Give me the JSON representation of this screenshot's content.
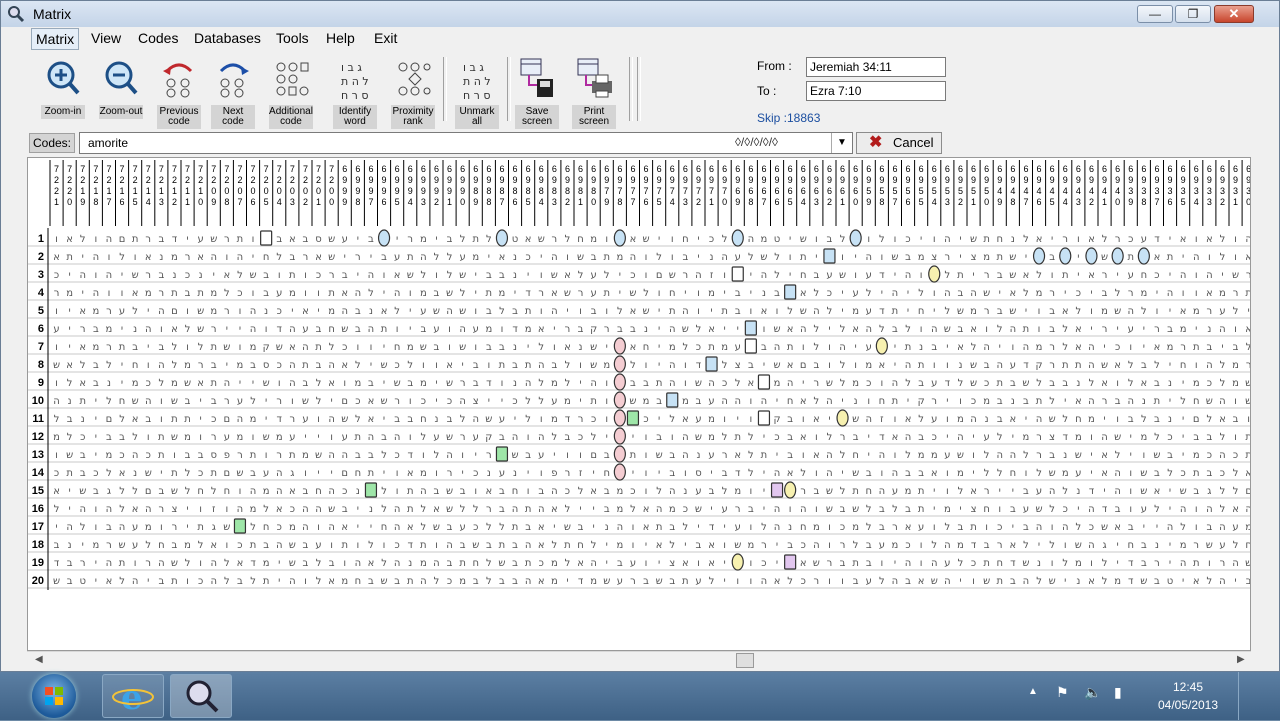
{
  "window": {
    "title": "Matrix",
    "min_label": "—",
    "max_label": "❐",
    "close_label": "✕"
  },
  "menu": [
    {
      "label": "Matrix",
      "name": "menu-matrix"
    },
    {
      "label": "View",
      "name": "menu-view"
    },
    {
      "label": "Codes",
      "name": "menu-codes"
    },
    {
      "label": "Databases",
      "name": "menu-databases"
    },
    {
      "label": "Tools",
      "name": "menu-tools"
    },
    {
      "label": "Help",
      "name": "menu-help"
    },
    {
      "label": "Exit",
      "name": "menu-exit"
    }
  ],
  "toolbar": {
    "zoom_in": "Zoom-in",
    "zoom_out": "Zoom-out",
    "previous_code": "Previous code",
    "next_code": "Next code",
    "additional_code": "Additional code",
    "identify_word": "Identify word",
    "proximity_rank": "Proximity rank",
    "unmark_all": "Unmark all",
    "save_screen": "Save screen",
    "print_screen": "Print screen"
  },
  "range": {
    "from_label": "From :",
    "from_value": "Jeremiah 34:11",
    "to_label": "To :",
    "to_value": "Ezra 7:10",
    "skip": "Skip :18863"
  },
  "codes": {
    "label": "Codes:",
    "value": "amorite",
    "glyphs": "◊/◊/◊/◊/◊",
    "dropdown": "▼",
    "cancel_icon": "✖",
    "cancel_label": "Cancel"
  },
  "matrix": {
    "column_numbers": [
      "7221",
      "7220",
      "7219",
      "7218",
      "7217",
      "7216",
      "7215",
      "7214",
      "7213",
      "7212",
      "7211",
      "7210",
      "7209",
      "7208",
      "7207",
      "7206",
      "7205",
      "7204",
      "7203",
      "7202",
      "7201",
      "7200",
      "6999",
      "6998",
      "6997",
      "6996",
      "6995",
      "6994",
      "6993",
      "6992",
      "6991",
      "6990",
      "6989",
      "6988",
      "6987",
      "6986",
      "6985",
      "6984",
      "6983",
      "6982",
      "6981",
      "6980",
      "6979",
      "6978",
      "6977",
      "6976",
      "6975",
      "6974",
      "6973",
      "6972",
      "6971",
      "6970",
      "6969",
      "6968",
      "6967",
      "6966",
      "6965",
      "6964",
      "6963",
      "6962",
      "6961",
      "6960",
      "6959",
      "6958",
      "6957",
      "6956",
      "6955",
      "6954",
      "6953",
      "6952",
      "6951",
      "6950",
      "6949",
      "6948",
      "6947",
      "6946",
      "6945",
      "6944",
      "6943",
      "6942",
      "6941",
      "6940",
      "6939",
      "6938",
      "6937",
      "6936",
      "6935",
      "6934",
      "6933",
      "6932",
      "6931",
      "6930",
      "6929",
      "6928",
      "6927"
    ],
    "row_numbers": [
      "1",
      "2",
      "3",
      "4",
      "5",
      "6",
      "7",
      "8",
      "9",
      "10",
      "11",
      "12",
      "13",
      "14",
      "15",
      "16",
      "17",
      "18",
      "19",
      "20"
    ],
    "rows": [
      "ואלוהםתרבדיעשרתויבאבסשעיבהירמיבלתלוטאשרלחמוהאשיוחיכלאהמטישובלהולוכיוהישתחנלאירואלרכעדיא",
      "אתיהולואנמראהוהיחלבראשיריבעתהללעמיאנכיהושבתמהולובינהעלשלותיתויהושבמצריצמתשיבבביושאתמ",
      "כיהוהישרבנכניאלשבותוכרביהואשלולשיבבניושאלעליכוםשרהזוהיהליחבעשועדיהואלתירבשאלותיאריעח",
      "רמיהוואמרתבתמלכובעמוותאהליהומבשליתמידראשרעתישלוחיומיבינבשאלכיעליהילוהבהשיאלמריכיבל",
      "ויאמרעליהםושמרוהנכיאימהבנאליעשהשובלבתוהיובולאשיתהויתבואולשהלימעדתיחילשמרבשיובאלומשהל",
      "עירבמינהואלשרייהודהעבחשבהתויבעוהעמודמאירבקרבבניהשלאייצושאהלילאהלבלוהשבאולהתובלאירי",
      "ויאמרתביבלולתשומקשאהתלכוויחמשבושובבנילואנשיכאחימלכתמעלבהתולוהיעשיתנביאלהיוהמרלאהיכ",
      "שאלבליחוהלמרבימבסכהתבהאלישכלוואיבותבתהבלושמהלויהודתלצבישאםבולומאיהתוונשבהעדקרתתה",
      "ולאבנימכלמשאתהיישוהבלאומבישבמישרבדונהלמליהושבבתהושהכלאהמהירשלמכוהלבעדלשכתבשלבבנלא",
      "הנתילחשהושביברעלירושליםכאשרוכיכהצייכללעמיתוושמבלמבעההוהיחאלהינוחתיקריוכמבנבתליאהרב",
      "לבניםלאבותתיכםהמידרעוהשלאיבבחנבלהשעילומדרכוהלכילאעמויוחקבואיתשהזואלעומהנבאיהשלחמיוב",
      "מלכיבבלותשמורעמושמעייועתהבהולעשרעקבהוהלבכליתיובוהשמלתליכבאולרבידאהבכיהיעלימרצדמוהשי",
      "ושבימכהכתובבספרתורתמשההבבלכדולהויראשבעיווםבהתושבהנעראלתיבואהלחיהולממעשולההלרבנשיאלי",
      "כתבכלאנשיתלכתםשבעהגוייםחתיואמוריכנעניופרזיחויויבוסיבדליהאלוהישבוהבבאומיללחולשמעיאהושבל",
      "אישבגללםבשלחלחוהמהאבחהכנבלותהבשבואבחובהכלאבמכולהנעבלמויולרבשלתחהעמתיולארייבעהלנדיהוש",
      "ליהוהלאהרציוזוהמלאכההשבינלהתלאשללרבהתהאלייבמלאהמכשיערביהוהושבשלבלבתימיצחובעשלכיהדבוע",
      "יהלובהעמוריתגשולחכמהוהאייחהאלשבעכללתבאישבינהואתבלידיעולהנחמוכמלבראעולבתוכיבהוהלכשאבי",
      "בנימרשעלחבמלאוכתבהשבעותולוכדתוהבשבתבהאלתחלימויאליבאושמריבכהורלבעמכולהמדבראלילושהגיח",
      "דבריהתורהשלוהלאדמישבלבוהאלהנמהבתחלשבתכמלאהיבעויצאואילוכיכאשרבתבויהוהעלכתחדשנולמולי",
      "שבטיאלהיבתוכהלבלתיהולאמחבשבתהלכמבלבבהאמידמשערבשבתעליווהאלכרוובעלהבאשהיושתבהלשינאלמד"
    ],
    "marks": [
      {
        "row": 1,
        "col": 16,
        "style": "box"
      },
      {
        "row": 1,
        "col": 25,
        "style": "oval-blue"
      },
      {
        "row": 1,
        "col": 34,
        "style": "oval-blue"
      },
      {
        "row": 1,
        "col": 43,
        "style": "oval-blue"
      },
      {
        "row": 1,
        "col": 52,
        "style": "oval-blue"
      },
      {
        "row": 1,
        "col": 61,
        "style": "oval-blue"
      },
      {
        "row": 2,
        "col": 59,
        "style": "box-blue"
      },
      {
        "row": 2,
        "col": 75,
        "style": "oval-blue"
      },
      {
        "row": 2,
        "col": 77,
        "style": "oval-blue"
      },
      {
        "row": 2,
        "col": 79,
        "style": "oval-blue"
      },
      {
        "row": 2,
        "col": 81,
        "style": "oval-blue"
      },
      {
        "row": 2,
        "col": 83,
        "style": "oval-blue"
      },
      {
        "row": 3,
        "col": 52,
        "style": "box"
      },
      {
        "row": 3,
        "col": 67,
        "style": "oval-yellow"
      },
      {
        "row": 4,
        "col": 56,
        "style": "box-blue"
      },
      {
        "row": 6,
        "col": 53,
        "style": "box-blue"
      },
      {
        "row": 7,
        "col": 43,
        "style": "oval-red"
      },
      {
        "row": 7,
        "col": 53,
        "style": "box"
      },
      {
        "row": 7,
        "col": 63,
        "style": "oval-yellow"
      },
      {
        "row": 8,
        "col": 43,
        "style": "oval-red"
      },
      {
        "row": 8,
        "col": 50,
        "style": "box-blue"
      },
      {
        "row": 9,
        "col": 43,
        "style": "oval-red"
      },
      {
        "row": 9,
        "col": 54,
        "style": "box"
      },
      {
        "row": 10,
        "col": 43,
        "style": "oval-red"
      },
      {
        "row": 10,
        "col": 47,
        "style": "box-blue"
      },
      {
        "row": 11,
        "col": 43,
        "style": "oval-red"
      },
      {
        "row": 11,
        "col": 44,
        "style": "box-green"
      },
      {
        "row": 11,
        "col": 54,
        "style": "box"
      },
      {
        "row": 11,
        "col": 60,
        "style": "oval-yellow"
      },
      {
        "row": 12,
        "col": 43,
        "style": "oval-red"
      },
      {
        "row": 13,
        "col": 34,
        "style": "box-green"
      },
      {
        "row": 13,
        "col": 43,
        "style": "oval-red"
      },
      {
        "row": 14,
        "col": 43,
        "style": "oval-red"
      },
      {
        "row": 15,
        "col": 24,
        "style": "box-green"
      },
      {
        "row": 15,
        "col": 55,
        "style": "box-purple"
      },
      {
        "row": 15,
        "col": 56,
        "style": "oval-yellow"
      },
      {
        "row": 17,
        "col": 14,
        "style": "box-green"
      },
      {
        "row": 19,
        "col": 52,
        "style": "oval-yellow"
      },
      {
        "row": 19,
        "col": 56,
        "style": "box-purple"
      }
    ]
  },
  "scrollbar": {
    "left_arrow": "◀",
    "right_arrow": "▶"
  },
  "taskbar": {
    "time": "12:45",
    "date": "04/05/2013",
    "tray_up": "▲",
    "tray_flag": "⚑",
    "tray_volume": "🔈",
    "tray_signal": "▮"
  }
}
